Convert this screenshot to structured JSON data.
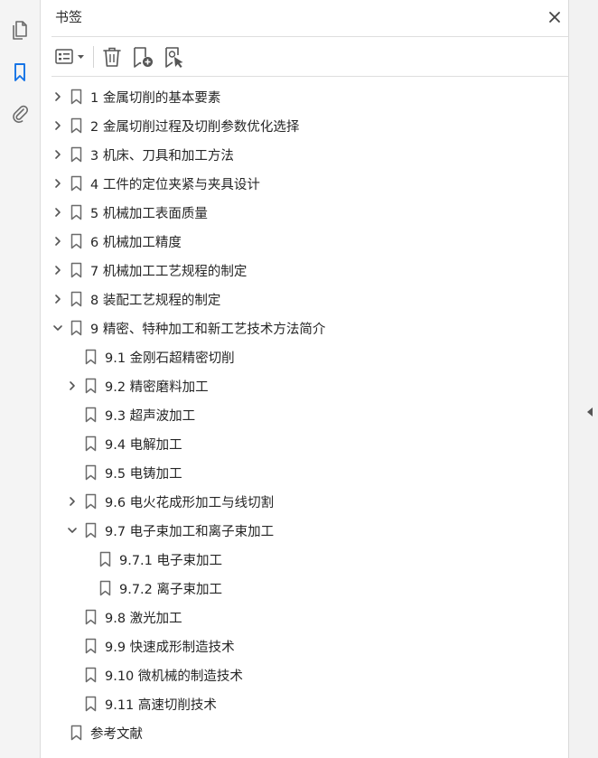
{
  "panel": {
    "title": "书签"
  },
  "icons": {
    "rail": [
      "pages-icon",
      "bookmark-icon",
      "attachment-icon"
    ],
    "toolbar": [
      "options-menu-icon",
      "delete-icon",
      "new-bookmark-icon",
      "bookmark-from-selection-icon"
    ]
  },
  "colors": {
    "accent": "#1473e6",
    "icon": "#6b6b6b",
    "text": "#262626"
  },
  "bookmarks": [
    {
      "label": "1 金属切削的基本要素",
      "level": 0,
      "state": "collapsed"
    },
    {
      "label": "2 金属切削过程及切削参数优化选择",
      "level": 0,
      "state": "collapsed"
    },
    {
      "label": "3 机床、刀具和加工方法",
      "level": 0,
      "state": "collapsed"
    },
    {
      "label": "4 工件的定位夹紧与夹具设计",
      "level": 0,
      "state": "collapsed"
    },
    {
      "label": "5 机械加工表面质量",
      "level": 0,
      "state": "collapsed"
    },
    {
      "label": "6 机械加工精度",
      "level": 0,
      "state": "collapsed"
    },
    {
      "label": "7 机械加工工艺规程的制定",
      "level": 0,
      "state": "collapsed"
    },
    {
      "label": "8 装配工艺规程的制定",
      "level": 0,
      "state": "collapsed"
    },
    {
      "label": "9 精密、特种加工和新工艺技术方法简介",
      "level": 0,
      "state": "expanded"
    },
    {
      "label": "9.1 金刚石超精密切削",
      "level": 1,
      "state": "leaf"
    },
    {
      "label": "9.2 精密磨料加工",
      "level": 1,
      "state": "collapsed"
    },
    {
      "label": "9.3 超声波加工",
      "level": 1,
      "state": "leaf"
    },
    {
      "label": "9.4 电解加工",
      "level": 1,
      "state": "leaf"
    },
    {
      "label": "9.5 电铸加工",
      "level": 1,
      "state": "leaf"
    },
    {
      "label": "9.6 电火花成形加工与线切割",
      "level": 1,
      "state": "collapsed"
    },
    {
      "label": "9.7 电子束加工和离子束加工",
      "level": 1,
      "state": "expanded"
    },
    {
      "label": "9.7.1 电子束加工",
      "level": 2,
      "state": "leaf"
    },
    {
      "label": "9.7.2 离子束加工",
      "level": 2,
      "state": "leaf"
    },
    {
      "label": "9.8 激光加工",
      "level": 1,
      "state": "leaf"
    },
    {
      "label": "9.9 快速成形制造技术",
      "level": 1,
      "state": "leaf"
    },
    {
      "label": "9.10 微机械的制造技术",
      "level": 1,
      "state": "leaf"
    },
    {
      "label": "9.11 高速切削技术",
      "level": 1,
      "state": "leaf"
    },
    {
      "label": "参考文献",
      "level": 0,
      "state": "leaf"
    }
  ]
}
